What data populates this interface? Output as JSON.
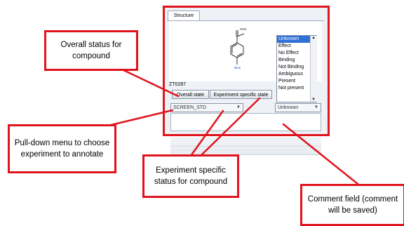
{
  "panel": {
    "tab_label": "Structure",
    "compound_id": "ZT0287",
    "overall_state_button": "Overall state",
    "experiment_state_button": "Experiment specific state",
    "experiment_select_value": "SCREEN_STD",
    "status_select_value": "Unknown",
    "comment_placeholder": ""
  },
  "status_options": [
    "Unknown",
    "Effect",
    "No Effect",
    "Binding",
    "Not Binding",
    "Ambiguous",
    "Present",
    "Not present"
  ],
  "structure_labels": {
    "methyl": "CH3",
    "amine": "NH2"
  },
  "callouts": {
    "overall": "Overall status for compound",
    "pulldown": "Pull-down menu to choose experiment to annotate",
    "experiment": "Experiment specific status for compound",
    "comment": "Comment field (comment will be saved)"
  },
  "colors": {
    "annotation_red": "#e0141c",
    "selection_blue": "#2f6fd6"
  }
}
